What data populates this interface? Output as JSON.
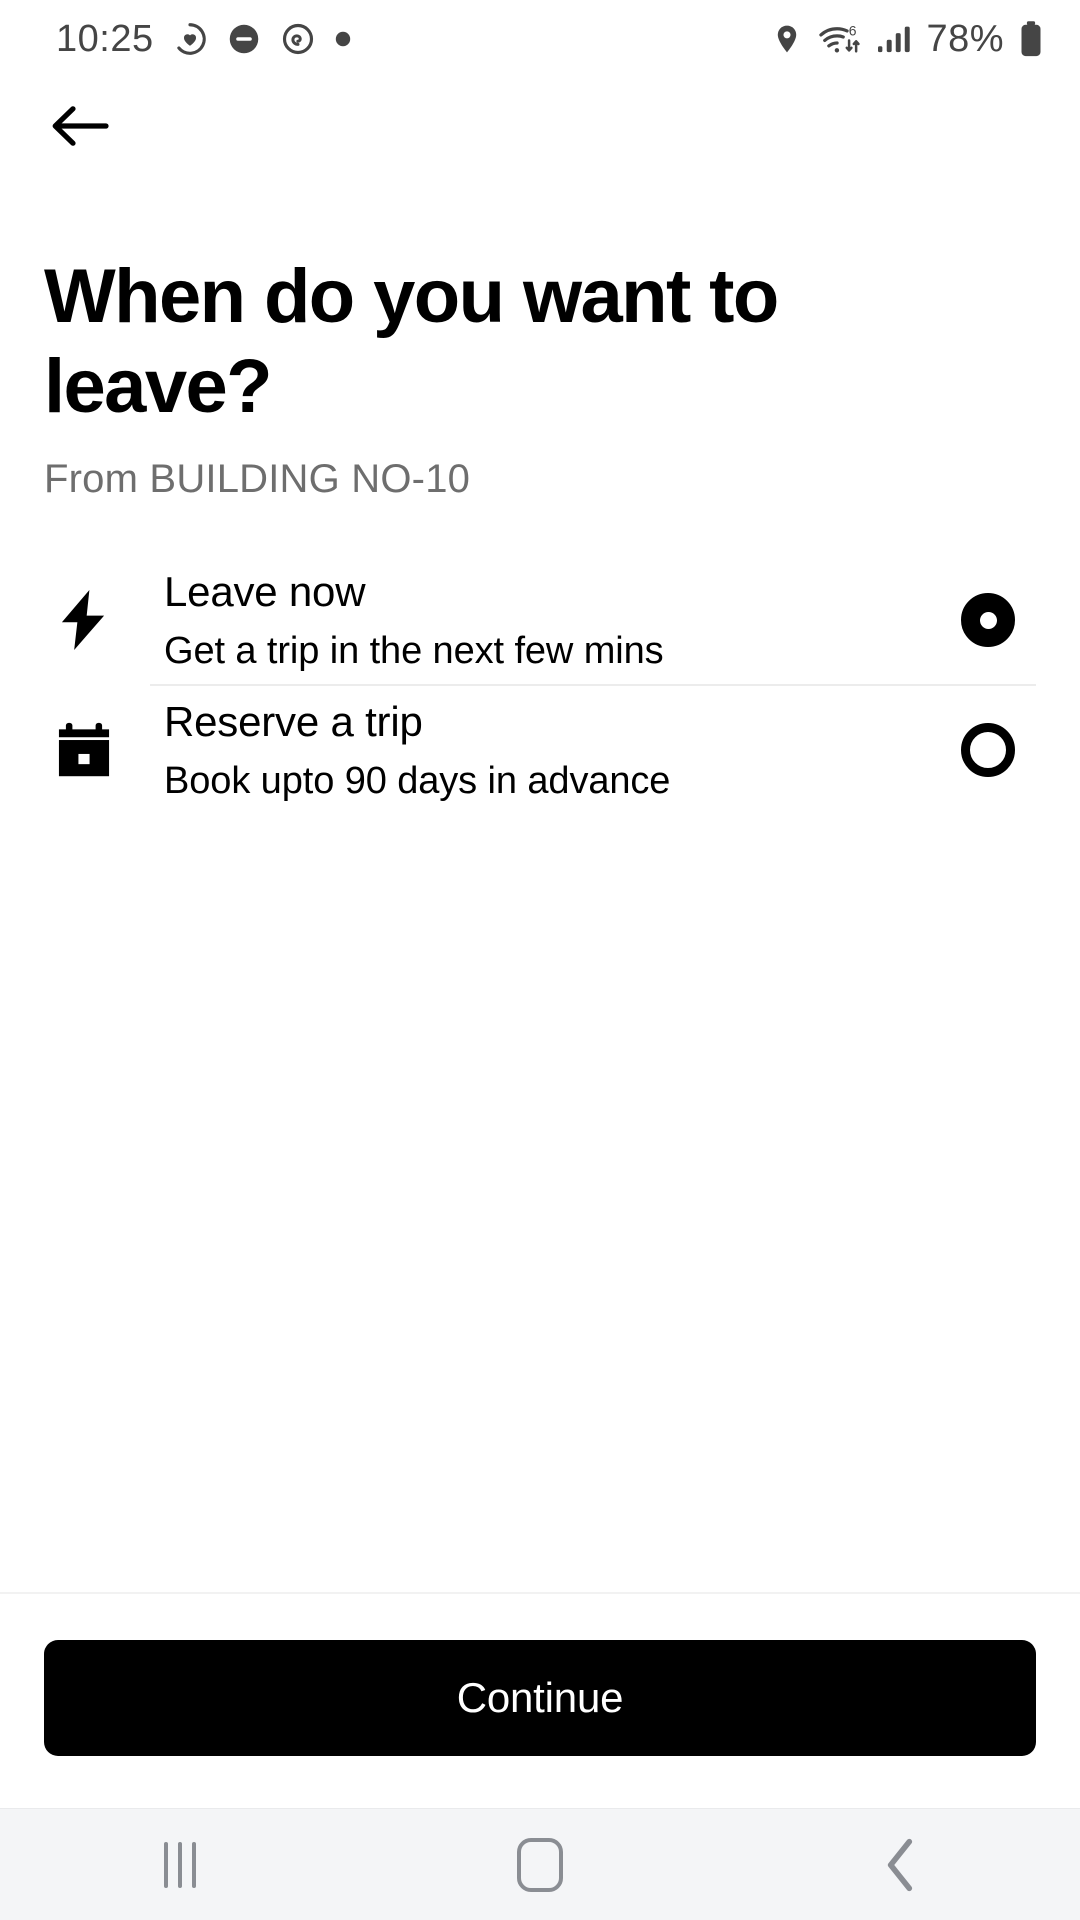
{
  "status_bar": {
    "time": "10:25",
    "battery_percent": "78%",
    "left_icons": [
      "heart-activity-icon",
      "do-not-disturb-icon",
      "alarm-icon",
      "dot-indicator-icon"
    ],
    "right_icons": [
      "location-pin-icon",
      "wifi-6-icon",
      "cellular-signal-icon",
      "battery-icon"
    ],
    "wifi_generation": "6",
    "text_color": "#454545"
  },
  "header": {
    "back_icon": "arrow-left-icon"
  },
  "main": {
    "title": "When do you want to leave?",
    "subtitle": "From BUILDING NO-10",
    "options": [
      {
        "id": "leave-now",
        "icon": "lightning-bolt-icon",
        "title": "Leave now",
        "subtitle": "Get a trip in the next few mins",
        "selected": true
      },
      {
        "id": "reserve-a-trip",
        "icon": "calendar-icon",
        "title": "Reserve a trip",
        "subtitle": "Book upto 90 days in advance",
        "selected": false
      }
    ]
  },
  "footer": {
    "continue_label": "Continue",
    "button_color": "#000000",
    "button_text_color": "#ffffff"
  },
  "nav_bar": {
    "recents_icon": "recents-icon",
    "home_icon": "home-icon",
    "back_icon": "chevron-left-icon",
    "background": "#f4f5f7",
    "icon_color": "#8a8d93"
  }
}
